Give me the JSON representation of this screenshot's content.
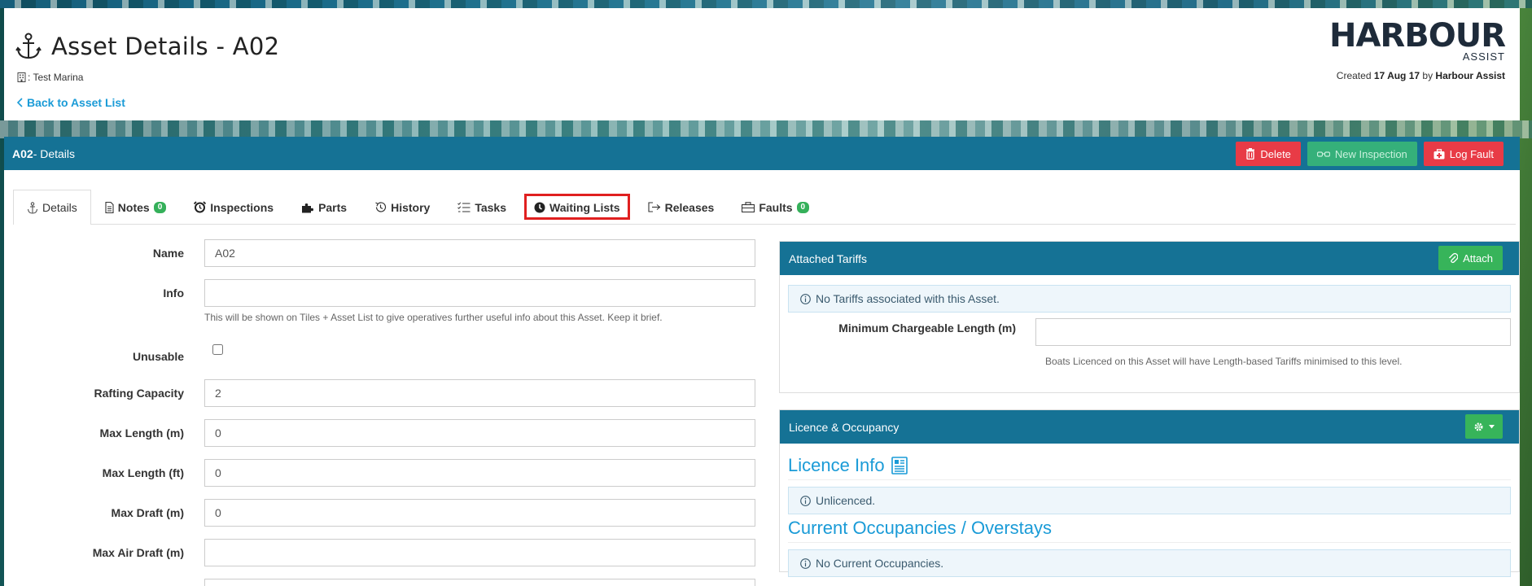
{
  "header": {
    "title": "Asset Details - A02",
    "marina": ": Test Marina",
    "back_link": "Back to Asset List",
    "logo": {
      "brand": "HARBOUR",
      "sub": "ASSIST"
    },
    "created_prefix": "Created ",
    "created_date": "17 Aug 17",
    "created_by_prefix": " by ",
    "created_by": "Harbour Assist"
  },
  "panel": {
    "asset_code": "A02",
    "title_suffix": " - Details",
    "actions": {
      "delete": "Delete",
      "new_inspection": "New Inspection",
      "log_fault": "Log Fault"
    }
  },
  "tabs": [
    {
      "label": "Details",
      "icon": "anchor-icon",
      "active": true
    },
    {
      "label": "Notes",
      "icon": "document-icon",
      "badge": "0"
    },
    {
      "label": "Inspections",
      "icon": "alarm-clock-icon"
    },
    {
      "label": "Parts",
      "icon": "puzzle-icon"
    },
    {
      "label": "History",
      "icon": "history-icon"
    },
    {
      "label": "Tasks",
      "icon": "task-list-icon"
    },
    {
      "label": "Waiting Lists",
      "icon": "clock-icon",
      "highlighted": true
    },
    {
      "label": "Releases",
      "icon": "sign-out-icon"
    },
    {
      "label": "Faults",
      "icon": "toolbox-icon",
      "badge": "0"
    }
  ],
  "form": {
    "name": {
      "label": "Name",
      "value": "A02"
    },
    "info": {
      "label": "Info",
      "value": "",
      "help": "This will be shown on Tiles + Asset List to give operatives further useful info about this Asset. Keep it brief."
    },
    "unusable": {
      "label": "Unusable",
      "checked": false
    },
    "rafting_capacity": {
      "label": "Rafting Capacity",
      "value": "2"
    },
    "max_length_m": {
      "label": "Max Length (m)",
      "value": "0"
    },
    "max_length_ft": {
      "label": "Max Length (ft)",
      "value": "0"
    },
    "max_draft_m": {
      "label": "Max Draft (m)",
      "value": "0"
    },
    "max_air_draft_m": {
      "label": "Max Air Draft (m)",
      "value": ""
    }
  },
  "tariffs": {
    "title": "Attached Tariffs",
    "attach_label": "Attach",
    "notice": "No Tariffs associated with this Asset.",
    "min_length_label": "Minimum Chargeable Length (m)",
    "min_length_value": "",
    "min_length_help": "Boats Licenced on this Asset will have Length-based Tariffs minimised to this level."
  },
  "licence": {
    "title": "Licence & Occupancy",
    "licence_info_heading": "Licence Info",
    "licence_notice": "Unlicenced.",
    "occupancy_heading": "Current Occupancies / Overstays",
    "occupancy_notice": "No Current Occupancies."
  },
  "colors": {
    "panel_blue": "#157295",
    "link_blue": "#1a9bd7",
    "danger_red": "#e83b46",
    "success_green": "#37b45a",
    "highlight_red": "#e02020"
  }
}
